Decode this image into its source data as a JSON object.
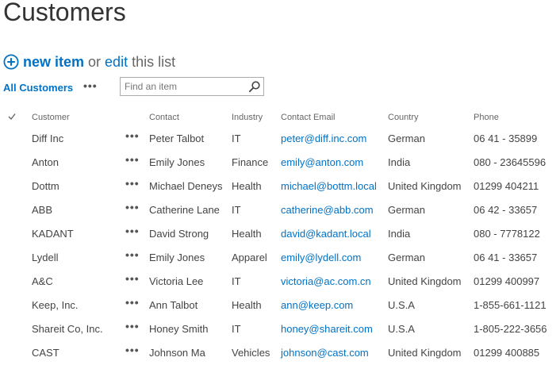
{
  "page": {
    "title": "Customers"
  },
  "actions": {
    "new_item": "new item",
    "or": "or",
    "edit": "edit",
    "this_list": "this list"
  },
  "view": {
    "name": "All Customers",
    "more": "•••"
  },
  "search": {
    "placeholder": "Find an item",
    "value": ""
  },
  "table": {
    "columns": {
      "customer": "Customer",
      "contact": "Contact",
      "industry": "Industry",
      "email": "Contact Email",
      "country": "Country",
      "phone": "Phone"
    },
    "row_menu": "•••",
    "rows": [
      {
        "customer": "Diff Inc",
        "contact": "Peter Talbot",
        "industry": "IT",
        "email": "peter@diff.inc.com",
        "country": "German",
        "phone": "06 41 - 35899"
      },
      {
        "customer": "Anton",
        "contact": "Emily Jones",
        "industry": "Finance",
        "email": "emily@anton.com",
        "country": "India",
        "phone": "080 - 23645596"
      },
      {
        "customer": "Dottm",
        "contact": "Michael Deneys",
        "industry": "Health",
        "email": "michael@bottm.local",
        "country": "United Kingdom",
        "phone": "01299 404211"
      },
      {
        "customer": "ABB",
        "contact": "Catherine Lane",
        "industry": "IT",
        "email": "catherine@abb.com",
        "country": "German",
        "phone": "06 42 - 33657"
      },
      {
        "customer": "KADANT",
        "contact": "David Strong",
        "industry": "Health",
        "email": "david@kadant.local",
        "country": "India",
        "phone": "080 - 7778122"
      },
      {
        "customer": "Lydell",
        "contact": "Emily Jones",
        "industry": "Apparel",
        "email": "emily@lydell.com",
        "country": "German",
        "phone": "06 41 - 33657"
      },
      {
        "customer": "A&C",
        "contact": "Victoria Lee",
        "industry": "IT",
        "email": "victoria@ac.com.cn",
        "country": "United Kingdom",
        "phone": "01299 400997"
      },
      {
        "customer": "Keep, Inc.",
        "contact": "Ann Talbot",
        "industry": "Health",
        "email": "ann@keep.com",
        "country": "U.S.A",
        "phone": "1-855-661-1121"
      },
      {
        "customer": "Shareit Co, Inc.",
        "contact": "Honey Smith",
        "industry": "IT",
        "email": "honey@shareit.com",
        "country": "U.S.A",
        "phone": "1-805-222-3656"
      },
      {
        "customer": "CAST",
        "contact": "Johnson Ma",
        "industry": "Vehicles",
        "email": "johnson@cast.com",
        "country": "United Kingdom",
        "phone": "01299 400885"
      }
    ]
  },
  "colors": {
    "accent": "#0072c6",
    "text": "#444444",
    "muted": "#666666"
  }
}
